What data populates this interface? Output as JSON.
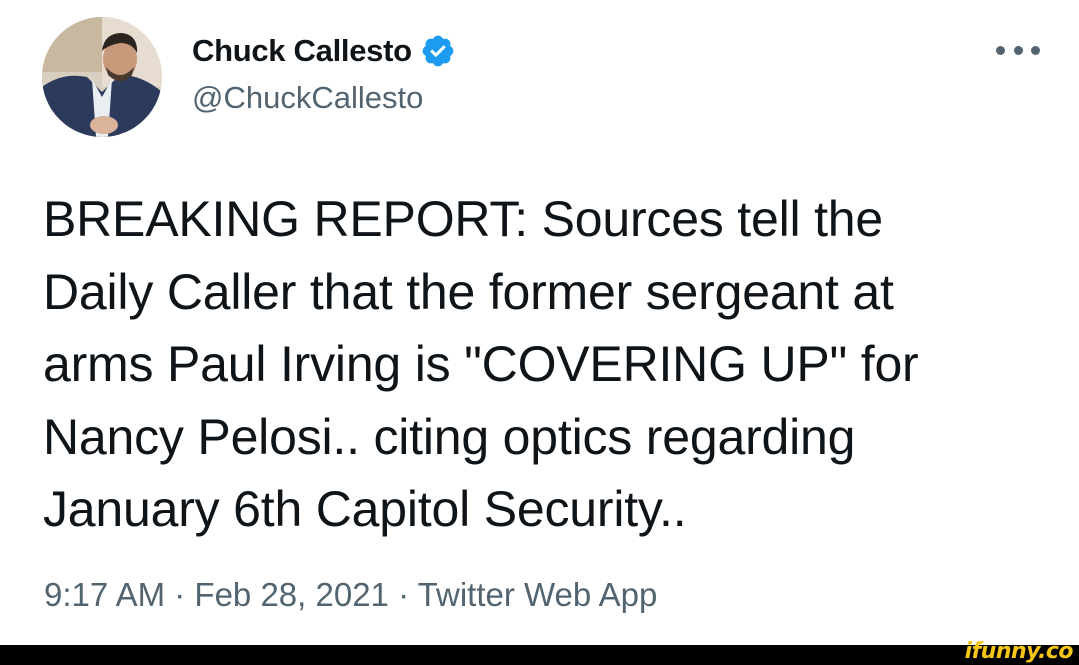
{
  "tweet": {
    "display_name": "Chuck Callesto",
    "handle": "@ChuckCallesto",
    "body": "BREAKING REPORT: Sources tell the\nDaily Caller that the former sergeant at\narms Paul Irving is \"COVERING UP\" for\nNancy Pelosi.. citing optics regarding\nJanuary 6th Capitol Security..",
    "time": "9:17 AM",
    "separator": "·",
    "date": "Feb 28, 2021",
    "source": "Twitter Web App",
    "verified": true
  },
  "icons": {
    "verified": "verified-badge-icon",
    "more": "more-options-icon"
  },
  "watermark": {
    "text": "ifunny.co"
  },
  "colors": {
    "name": "#0f1419",
    "secondary": "#536471",
    "verified": "#1d9bf0",
    "footer": "#000000",
    "watermark": "#f5c518"
  }
}
